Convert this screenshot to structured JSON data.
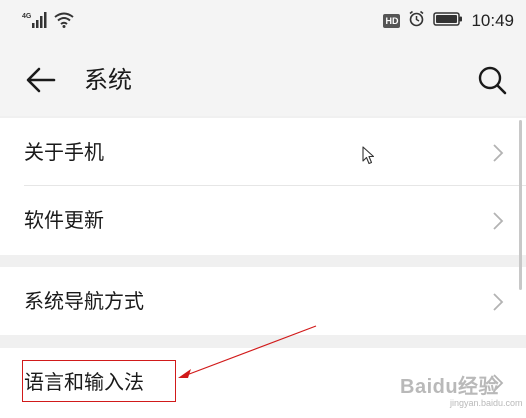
{
  "status_bar": {
    "network_label": "4G",
    "time": "10:49",
    "hd_label": "HD"
  },
  "header": {
    "title": "系统"
  },
  "menu": [
    {
      "label": "关于手机"
    },
    {
      "label": "软件更新"
    },
    {
      "label": "系统导航方式"
    },
    {
      "label": "语言和输入法"
    }
  ],
  "watermark": {
    "text": "Baidu经验",
    "sub": "jingyan.baidu.com"
  },
  "colors": {
    "annotation_red": "#d11a1a",
    "background": "#f0f0f0",
    "card": "#ffffff"
  }
}
